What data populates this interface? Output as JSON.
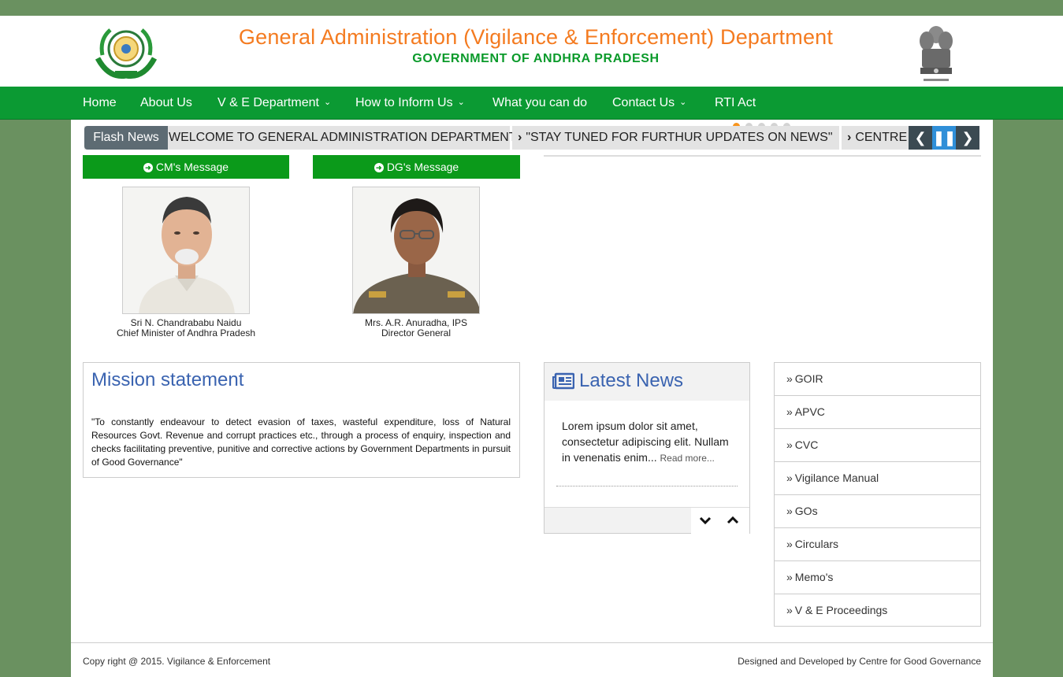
{
  "header": {
    "title": "General Administration (Vigilance & Enforcement) Department",
    "subtitle": "GOVERNMENT OF ANDHRA PRADESH"
  },
  "nav": {
    "items": [
      {
        "label": "Home"
      },
      {
        "label": "About Us"
      },
      {
        "label": "V & E Department"
      },
      {
        "label": "How to Inform Us"
      },
      {
        "label": "What you can do"
      },
      {
        "label": "Contact Us"
      },
      {
        "label": "RTI Act"
      }
    ],
    "dropdown_icon": "chevron-down-icon"
  },
  "slider": {
    "dot_count": 5,
    "active_index": 0,
    "colors": {
      "active": "#f7941d",
      "inactive": "#d3d3d3"
    }
  },
  "flash": {
    "label": "Flash News",
    "items": [
      "WELCOME TO GENERAL ADMINISTRATION DEPARTMENT",
      "\"STAY TUNED FOR FURTHUR UPDATES ON NEWS\"",
      "CENTRE FOR GOOD GOVERNANCE"
    ],
    "controls": [
      "chevron-left-icon",
      "pause-icon",
      "chevron-right-icon"
    ]
  },
  "messages": {
    "cm": {
      "button": "CM's Message",
      "name": "Sri N. Chandrababu Naidu",
      "role": "Chief Minister of Andhra Pradesh"
    },
    "dg": {
      "button": "DG's Message",
      "name": "Mrs. A.R. Anuradha, IPS",
      "role": "Director General"
    }
  },
  "mission": {
    "title": "Mission statement",
    "text": "\"To constantly endeavour to detect evasion of taxes, wasteful expenditure, loss of Natural Resources Govt. Revenue and corrupt practices etc., through a process of enquiry, inspection and checks facilitating preventive, punitive and corrective actions by Government Departments in pursuit of Good Governance\""
  },
  "news": {
    "title": "Latest News",
    "body": "Lorem ipsum dolor sit amet, consectetur adipiscing elit. Nullam in venenatis enim...",
    "more": "Read more..."
  },
  "sidebar": {
    "links": [
      "GOIR",
      "APVC",
      "CVC",
      "Vigilance Manual",
      "GOs",
      "Circulars",
      "Memo's",
      "V & E Proceedings"
    ]
  },
  "footer": {
    "left": "Copy right @ 2015. Vigilance & Enforcement",
    "right": "Designed and Developed by Centre for Good Governance"
  },
  "colors": {
    "background": "#6a9160",
    "nav": "#0b9a33",
    "title": "#f47b20",
    "subtitle": "#0a9a2a",
    "heading": "#3a63b0",
    "message_button": "#0b9a1a"
  }
}
